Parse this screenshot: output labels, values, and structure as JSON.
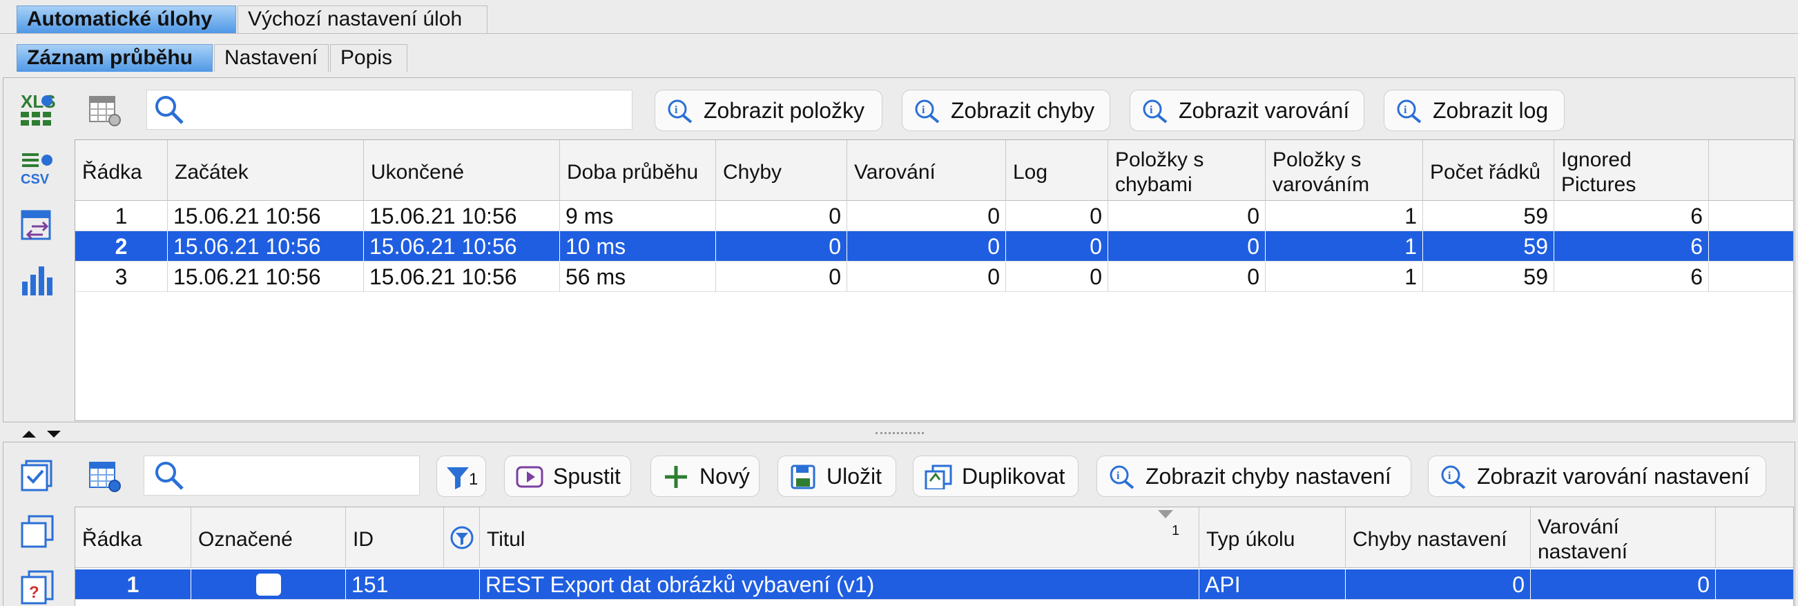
{
  "tabs_top": [
    "Automatické úlohy",
    "Výchozí nastavení úloh"
  ],
  "tabs_sub": [
    "Záznam průběhu",
    "Nastavení",
    "Popis"
  ],
  "upper": {
    "buttons": [
      "Zobrazit položky",
      "Zobrazit chyby",
      "Zobrazit varování",
      "Zobrazit log"
    ],
    "columns": [
      "Řádka",
      "Začátek",
      "Ukončené",
      "Doba průběhu",
      "Chyby",
      "Varování",
      "Log",
      "Položky s chybami",
      "Položky s varováním",
      "Počet řádků",
      "Ignored Pictures"
    ],
    "rows": [
      [
        "1",
        "15.06.21 10:56",
        "15.06.21 10:56",
        "9 ms",
        "0",
        "0",
        "0",
        "0",
        "1",
        "59",
        "6"
      ],
      [
        "2",
        "15.06.21 10:56",
        "15.06.21 10:56",
        "10 ms",
        "0",
        "0",
        "0",
        "0",
        "1",
        "59",
        "6"
      ],
      [
        "3",
        "15.06.21 10:56",
        "15.06.21 10:56",
        "56 ms",
        "0",
        "0",
        "0",
        "0",
        "1",
        "59",
        "6"
      ]
    ],
    "selected_row": 2
  },
  "lower": {
    "filter_count": "1",
    "buttons": [
      "Spustit",
      "Nový",
      "Uložit",
      "Duplikovat",
      "Zobrazit chyby nastavení",
      "Zobrazit varování nastavení"
    ],
    "columns": [
      "Řádka",
      "Označené",
      "ID",
      "Titul",
      "Typ úkolu",
      "Chyby nastavení",
      "Varování nastavení"
    ],
    "sort_index": "1",
    "rows": [
      [
        "1",
        "",
        "151",
        "REST Export dat obrázků vybavení (v1)",
        "API",
        "0",
        "0"
      ]
    ]
  },
  "icons": {
    "xls": "XLS",
    "csv": "CSV"
  },
  "colors": {
    "selection": "#1f5ee0",
    "accent": "#2a6fd6",
    "tab_active": "#4f98e6"
  }
}
